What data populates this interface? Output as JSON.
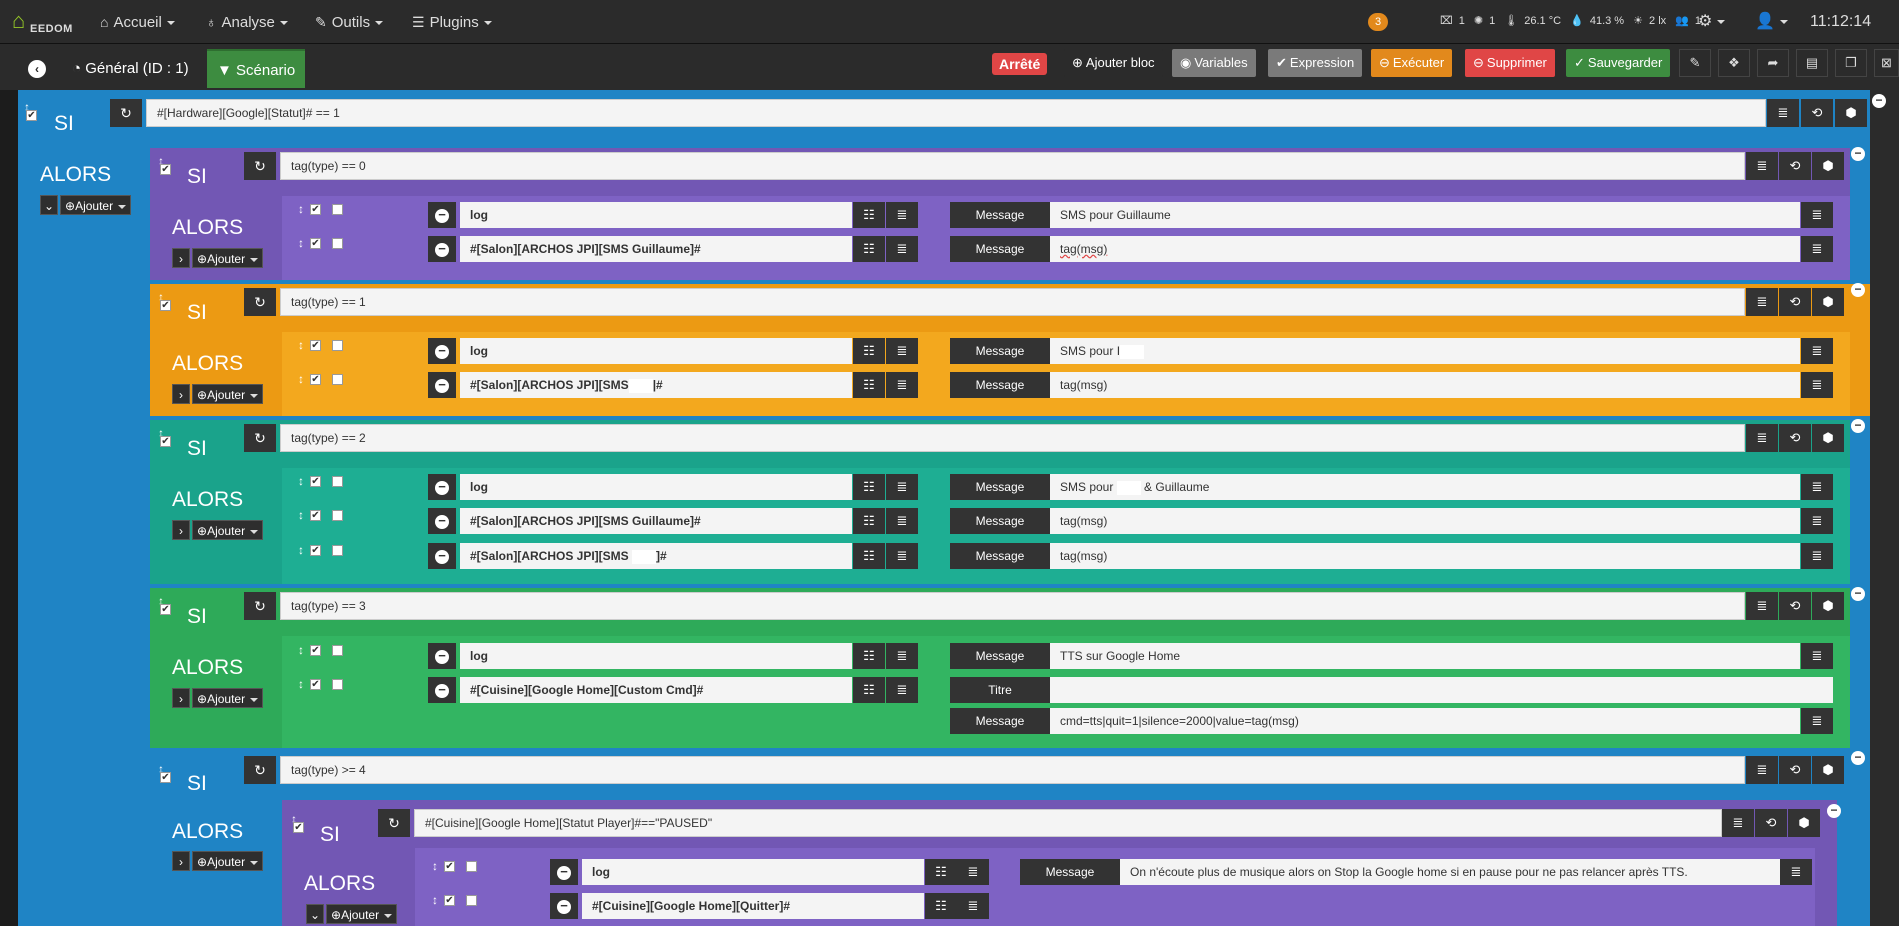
{
  "nav": {
    "brand": "EEDOM",
    "items": [
      {
        "label": "Accueil",
        "icon": "home-icon"
      },
      {
        "label": "Analyse",
        "icon": "stethoscope-icon"
      },
      {
        "label": "Outils",
        "icon": "wrench-icon"
      },
      {
        "label": "Plugins",
        "icon": "list-icon"
      }
    ],
    "notification_count": "3",
    "summary": {
      "doors": "1",
      "lights": "1",
      "temperature": "26.1 °C",
      "humidity": "41.3 %",
      "luminosity": "2 lx",
      "presence": "1"
    },
    "time": "11:12:14"
  },
  "toolbar": {
    "tabs": [
      {
        "label": "Général (ID : 1)",
        "icon": "dashboard-icon"
      },
      {
        "label": "Scénario",
        "icon": "filter-icon"
      }
    ],
    "state_badge": "Arrêté",
    "buttons": [
      {
        "label": "Ajouter bloc",
        "color": "#2b2b2b"
      },
      {
        "label": "Variables",
        "color": "#7a7a7a"
      },
      {
        "label": "Expression",
        "color": "#7a7a7a"
      },
      {
        "label": "Exécuter",
        "color": "#e2891c"
      },
      {
        "label": "Supprimer",
        "color": "#e04646"
      },
      {
        "label": "Sauvegarder",
        "color": "#3d8c40"
      }
    ]
  },
  "scenario": {
    "si_label": "SI",
    "alors_label": "ALORS",
    "add_label": "Ajouter",
    "message_label": "Message",
    "title_label": "Titre",
    "root_condition": "#[Hardware][Google][Statut]# == 1",
    "blocks": [
      {
        "condition": "tag(type) == 0",
        "color": "#7257b4",
        "actions": [
          {
            "cmd": "log",
            "message": "SMS pour Guillaume"
          },
          {
            "cmd": "#[Salon][ARCHOS JPI][SMS Guillaume]#",
            "message": "tag(msg)"
          }
        ]
      },
      {
        "condition": "tag(type) == 1",
        "color": "#ec9a13",
        "actions": [
          {
            "cmd": "log",
            "message": "SMS pour I"
          },
          {
            "cmd_pre": "#[Salon][ARCHOS JPI][SMS",
            "cmd_post": "|#",
            "message": "tag(msg)"
          }
        ]
      },
      {
        "condition": "tag(type)  == 2",
        "color": "#1aa38b",
        "actions": [
          {
            "cmd": "log",
            "message_pre": "SMS pour",
            "message_post": "& Guillaume"
          },
          {
            "cmd": "#[Salon][ARCHOS JPI][SMS Guillaume]#",
            "message": "tag(msg)"
          },
          {
            "cmd_pre": "#[Salon][ARCHOS JPI][SMS",
            "cmd_post": "]#",
            "message": "tag(msg)"
          }
        ]
      },
      {
        "condition": "tag(type)  == 3",
        "color": "#2eaa59",
        "actions": [
          {
            "cmd": "log",
            "message": "TTS sur Google Home"
          },
          {
            "cmd": "#[Cuisine][Google Home][Custom Cmd]#",
            "title": "",
            "message": "cmd=tts|quit=1|silence=2000|value=tag(msg)"
          }
        ]
      },
      {
        "condition": "tag(type)  >= 4",
        "color": "#1f84c5",
        "nested": {
          "condition": "#[Cuisine][Google Home][Statut Player]#==\"PAUSED\"",
          "color": "#7257b4",
          "actions": [
            {
              "cmd": "log",
              "message": "On n'écoute plus de musique alors on Stop la Google home si en pause pour ne pas relancer après TTS."
            },
            {
              "cmd": "#[Cuisine][Google Home][Quitter]#"
            }
          ]
        }
      }
    ]
  }
}
